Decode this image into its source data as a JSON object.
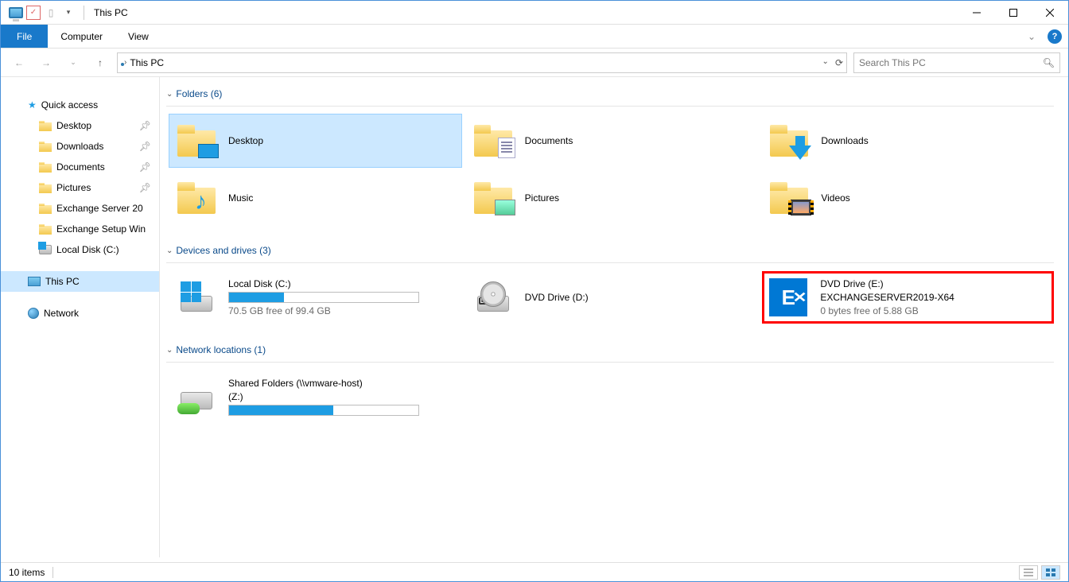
{
  "window": {
    "title": "This PC"
  },
  "ribbon": {
    "file": "File",
    "tabs": [
      "Computer",
      "View"
    ]
  },
  "address": {
    "location": "This PC",
    "search_placeholder": "Search This PC"
  },
  "sidebar": {
    "quick_access": "Quick access",
    "quick_items": [
      {
        "label": "Desktop",
        "pinned": true
      },
      {
        "label": "Downloads",
        "pinned": true
      },
      {
        "label": "Documents",
        "pinned": true
      },
      {
        "label": "Pictures",
        "pinned": true
      },
      {
        "label": "Exchange Server 20",
        "pinned": false
      },
      {
        "label": "Exchange Setup Win",
        "pinned": false
      },
      {
        "label": "Local Disk (C:)",
        "pinned": false,
        "icon": "drive"
      }
    ],
    "this_pc": "This PC",
    "network": "Network"
  },
  "groups": {
    "folders": {
      "header": "Folders (6)",
      "items": [
        {
          "name": "Desktop",
          "icon": "desktop"
        },
        {
          "name": "Documents",
          "icon": "documents"
        },
        {
          "name": "Downloads",
          "icon": "downloads"
        },
        {
          "name": "Music",
          "icon": "music"
        },
        {
          "name": "Pictures",
          "icon": "pictures"
        },
        {
          "name": "Videos",
          "icon": "videos"
        }
      ]
    },
    "drives": {
      "header": "Devices and drives (3)",
      "items": [
        {
          "name": "Local Disk (C:)",
          "sub": "70.5 GB free of 99.4 GB",
          "fill_pct": 29,
          "icon": "hdd"
        },
        {
          "name": "DVD Drive (D:)",
          "icon": "dvd"
        },
        {
          "name": "DVD Drive (E:)",
          "name2": "EXCHANGESERVER2019-X64",
          "sub": "0 bytes free of 5.88 GB",
          "icon": "exchange",
          "highlight": true
        }
      ]
    },
    "network": {
      "header": "Network locations (1)",
      "items": [
        {
          "name": "Shared Folders (\\\\vmware-host)",
          "name2": "(Z:)",
          "fill_pct": 55,
          "icon": "netdrive"
        }
      ]
    }
  },
  "status": {
    "text": "10 items"
  }
}
